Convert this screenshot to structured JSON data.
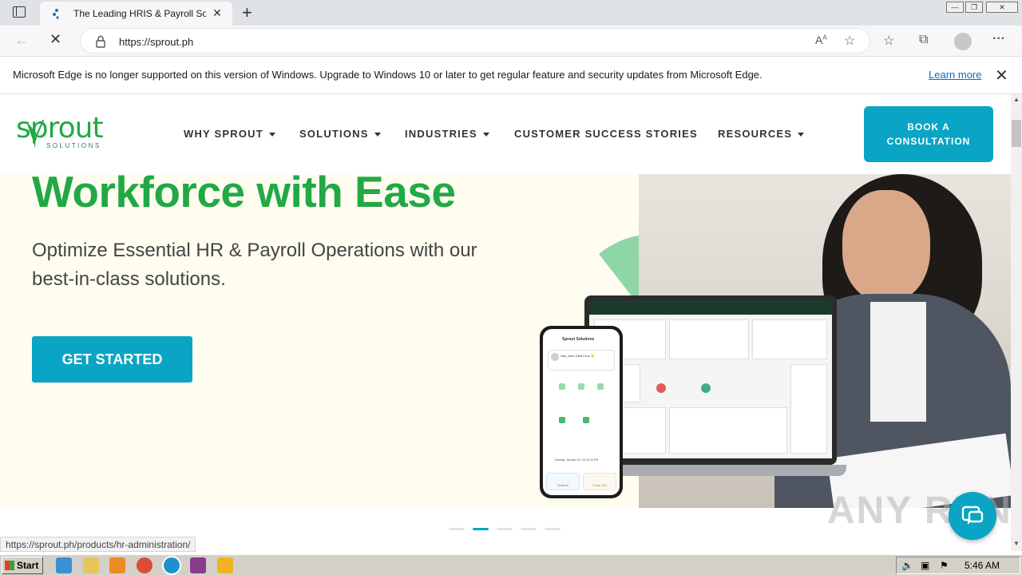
{
  "browser": {
    "tab_title": "The Leading HRIS & Payroll Sof",
    "tab_close": "✕",
    "new_tab": "+",
    "url": "https://sprout.ph",
    "status_url": "https://sprout.ph/products/hr-administration/"
  },
  "infobar": {
    "message": "Microsoft Edge is no longer supported on this version of Windows. Upgrade to Windows 10 or later to get regular feature and security updates from Microsoft Edge.",
    "learn_more": "Learn more",
    "close": "✕"
  },
  "site": {
    "logo_word": "sprout",
    "logo_sub": "SOLUTIONS",
    "nav": [
      {
        "label": "WHY SPROUT",
        "dropdown": true
      },
      {
        "label": "SOLUTIONS",
        "dropdown": true
      },
      {
        "label": "INDUSTRIES",
        "dropdown": true
      },
      {
        "label": "CUSTOMER SUCCESS STORIES",
        "dropdown": false
      },
      {
        "label": "RESOURCES",
        "dropdown": true
      }
    ],
    "cta": "BOOK A CONSULTATION"
  },
  "hero": {
    "headline": "Workforce with Ease",
    "subline": "Optimize Essential HR & Payroll Operations with our best-in-class solutions.",
    "button": "GET STARTED",
    "slides_total": 5,
    "slide_active": 2
  },
  "phone": {
    "title": "Sprout Solutions",
    "greeting": "Hey, Juan Dela Cruz 👋",
    "footer": "Tuesday, January 16 • 00:10:00 PM",
    "clock_in": "Clock In",
    "clock_out": "Clock Out"
  },
  "watermark": "ANY RUN",
  "taskbar": {
    "start": "Start",
    "time": "5:46 AM"
  },
  "colors": {
    "brand_green": "#22a845",
    "brand_teal": "#0aa4c4",
    "hero_bg": "#fefdf0"
  }
}
